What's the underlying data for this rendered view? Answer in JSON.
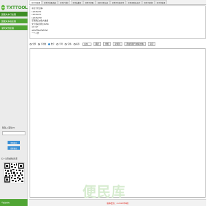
{
  "sidebar": {
    "logo_mark": "txt",
    "logo_text": "TXTTOOL",
    "nav": [
      {
        "label": "国服文本行处理",
        "active": true
      },
      {
        "label": "国服文本格处理",
        "active": false
      },
      {
        "label": "滚筒文档处理",
        "active": false
      }
    ],
    "input_label": "随输入滚动2b",
    "button1": "索取滚动",
    "button2": "搜索滚动",
    "qr_label": "扫一扫添加微信客服",
    "copyright": "©版权所有"
  },
  "tabs": [
    {
      "label": "文本行处理",
      "active": true
    },
    {
      "label": "文本行批量改变",
      "active": false
    },
    {
      "label": "文本行排序",
      "active": false
    },
    {
      "label": "文本去重组",
      "active": false
    },
    {
      "label": "文本行提取",
      "active": false
    },
    {
      "label": "固定文本长度",
      "active": false
    },
    {
      "label": "文本行添加文本",
      "active": false
    },
    {
      "label": "文本正则表达式",
      "active": false
    },
    {
      "label": "文本行转换",
      "active": false
    },
    {
      "label": "文本行处理",
      "active": false
    }
  ],
  "panel_lines": [
    "中文字符文本",
    "12345678",
    "12345678",
    "12345678!",
    "互联网后文化大数据",
    "文字语段示例_RANK",
    "abcdef",
    "abfeffffeeffeffefef",
    "一个人的"
  ],
  "options": {
    "radios": [
      {
        "label": "全部",
        "on": false
      },
      {
        "label": "下划线",
        "on": false
      },
      {
        "label": "数字",
        "on": true
      },
      {
        "label": "字母",
        "on": false
      },
      {
        "label": "空格",
        "on": false
      },
      {
        "label": "标签",
        "on": false
      }
    ],
    "num_value": "示例1",
    "btn_apply": "确定",
    "btn_reset": "重置",
    "btn_copy": "复制为",
    "btn_add": "添加到新行/末尾/文本",
    "btn_clear": "清空"
  },
  "watermark": "便民库",
  "status": "版本更新：2.2023年6期"
}
